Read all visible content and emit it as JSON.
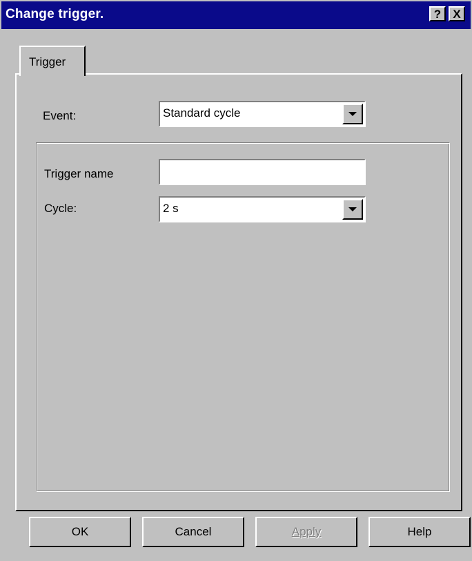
{
  "window": {
    "title": "Change trigger.",
    "help_glyph": "?",
    "close_glyph": "X"
  },
  "tabs": [
    {
      "label": "Trigger",
      "selected": true
    }
  ],
  "event": {
    "label": "Event:",
    "value": "Standard cycle"
  },
  "trigger_name": {
    "label": "Trigger name",
    "value": ""
  },
  "cycle": {
    "label": "Cycle:",
    "value": "2 s"
  },
  "buttons": {
    "ok": "OK",
    "cancel": "Cancel",
    "apply": "Apply",
    "help": "Help"
  },
  "colors": {
    "titlebar": "#0a0a8a",
    "face": "#c0c0c0",
    "disabled_text": "#808080"
  },
  "icons": {
    "help": "help-icon",
    "close": "close-icon",
    "dropdown": "chevron-down-icon"
  }
}
